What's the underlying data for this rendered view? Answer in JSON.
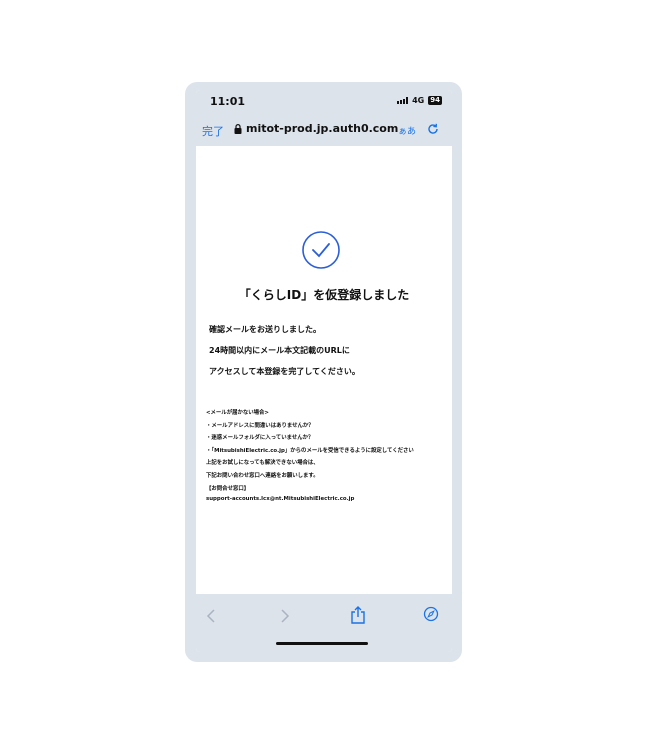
{
  "status": {
    "time": "11:01",
    "network": "4G",
    "battery": "94"
  },
  "browser": {
    "done_label": "完了",
    "url": "mitot-prod.jp.auth0.com",
    "text_size_label": "ぁあ"
  },
  "page": {
    "title": "「くらしID」を仮登録しました",
    "message_lines": [
      "確認メールをお送りしました。",
      "24時間以内にメール本文記載のURLに",
      "アクセスして本登録を完了してください。"
    ],
    "notes": [
      "<メールが届かない場合>",
      "・メールアドレスに間違いはありませんか？",
      "・迷惑メールフォルダに入っていませんか？",
      "・「MitsubishiElectric.co.jp」からのメールを受信できるように設定してください",
      "上記をお試しになっても解決できない場合は、",
      "下記お問い合わせ窓口へ連絡をお願いします。",
      "【お問合せ窓口】",
      "support-accounts.lcx@nt.MitsubishiElectric.co.jp"
    ]
  },
  "colors": {
    "accent": "#1a73e8",
    "chrome": "#dce3ea",
    "check": "#2b5fd9"
  }
}
